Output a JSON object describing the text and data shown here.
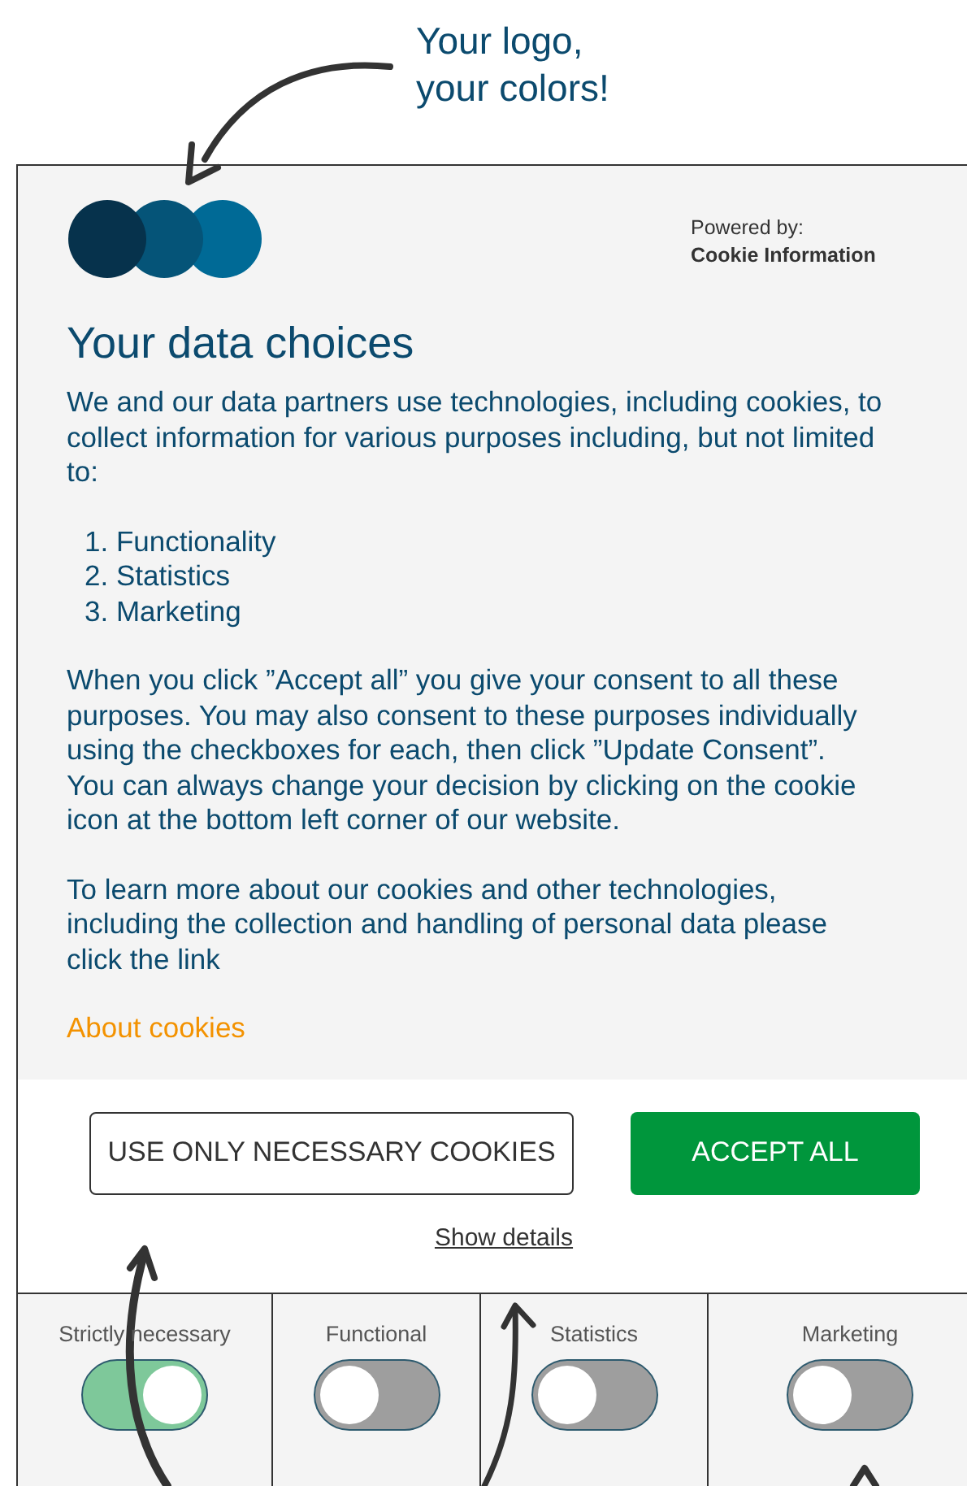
{
  "callout": {
    "lines": [
      "Your logo,",
      "your colors!"
    ]
  },
  "banner": {
    "powered_by": "Powered by:",
    "provider": "Cookie Information",
    "title": "Your data choices",
    "intro": "We and our data partners use technologies, including cookies, to collect information for various purposes including, but not limited to:",
    "purposes": [
      {
        "number": "1.",
        "label": "Functionality"
      },
      {
        "number": "2.",
        "label": "Statistics"
      },
      {
        "number": "3.",
        "label": "Marketing"
      }
    ],
    "paragraphs": [
      "When you click ”Accept all” you give your consent to all these purposes. You may also consent to these purposes individually using the checkboxes for each, then click ”Update Consent”. You can always change your decision by clicking on the cookie icon at the bottom left corner of our website.",
      "To learn more about our cookies and other technologies, including the collection and handling of personal data please click the link"
    ],
    "link": "About cookies",
    "buttons": [
      {
        "kind": "outline",
        "label": "USE ONLY NECESSARY COOKIES"
      },
      {
        "kind": "primary",
        "label": "ACCEPT ALL"
      }
    ],
    "details_link": "Show details",
    "categories": [
      {
        "label": "Strictly necessary",
        "on": true
      },
      {
        "label": "Functional",
        "on": false
      },
      {
        "label": "Statistics",
        "on": false
      },
      {
        "label": "Marketing",
        "on": false
      }
    ]
  }
}
